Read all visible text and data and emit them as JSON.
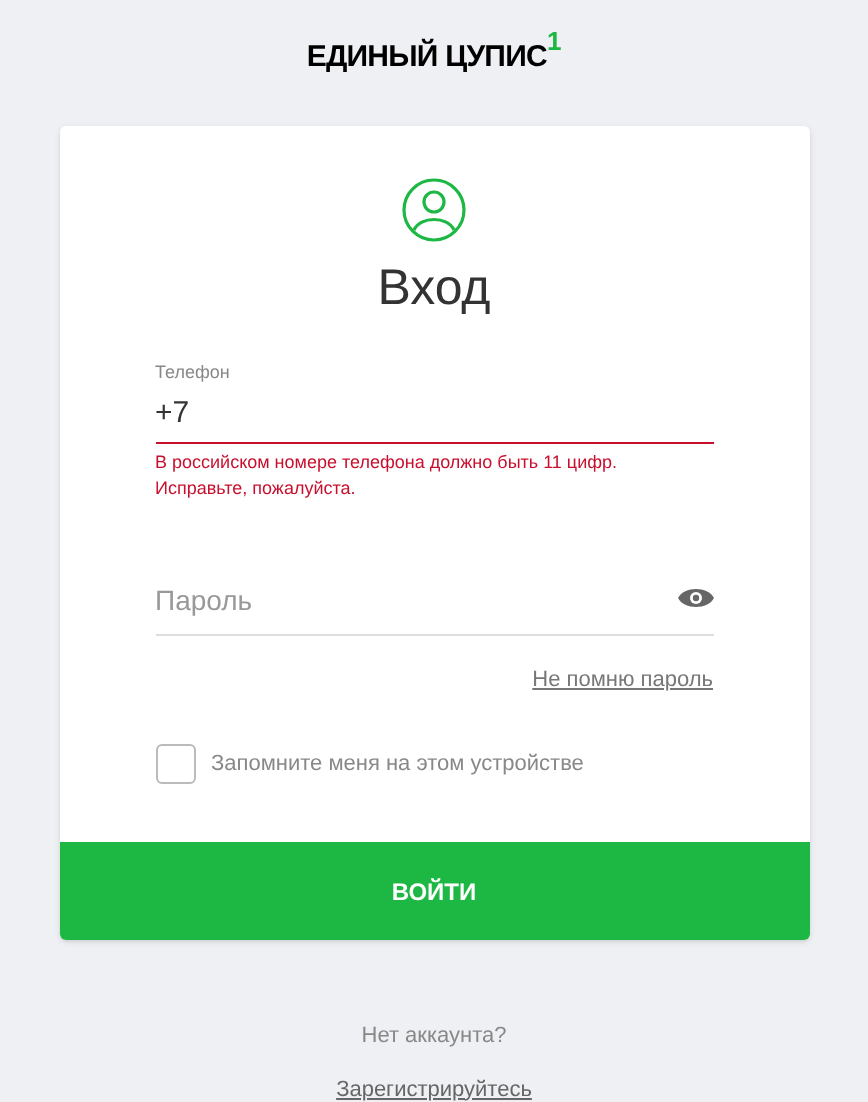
{
  "logo": {
    "text": "ЕДИНЫЙ ЦУПИС",
    "mark": "1"
  },
  "form": {
    "title": "Вход",
    "phone": {
      "label": "Телефон",
      "value": "+7",
      "error": "В российском номере телефона должно быть 11 цифр. Исправьте, пожалуйста."
    },
    "password": {
      "placeholder": "Пароль"
    },
    "forgot_link": "Не помню пароль",
    "remember": {
      "label": "Запомните меня на этом устройстве",
      "checked": false
    },
    "submit": "ВОЙТИ"
  },
  "footer": {
    "text": "Нет аккаунта?",
    "link": "Зарегистрируйтесь"
  }
}
